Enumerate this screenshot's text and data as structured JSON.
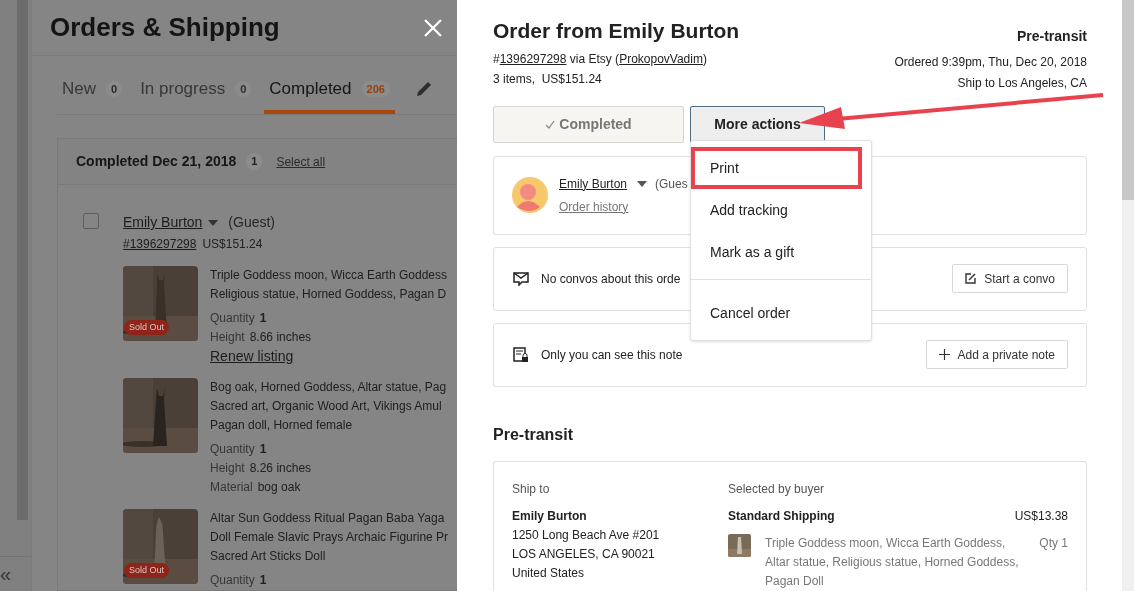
{
  "backdrop": {
    "collapse_glyph": "«"
  },
  "orders_panel": {
    "title": "Orders & Shipping",
    "tabs": [
      {
        "label": "New",
        "count": "0",
        "selected": false
      },
      {
        "label": "In progress",
        "count": "0",
        "selected": false
      },
      {
        "label": "Completed",
        "count": "206",
        "selected": true
      }
    ],
    "group": {
      "title": "Completed Dec 21, 2018",
      "count": "1",
      "select_all": "Select all"
    },
    "order": {
      "checked": false,
      "buyer": "Emily Burton",
      "buyer_note": "(Guest)",
      "number": "#1396297298",
      "total": "US$151.24",
      "items": [
        {
          "title_lines": [
            "Triple Goddess moon, Wicca Earth Goddess",
            "Religious statue, Horned Goddess, Pagan D"
          ],
          "sold_out": "Sold Out",
          "details": [
            {
              "label": "Quantity",
              "value": "1",
              "bold": true
            },
            {
              "label": "Height",
              "value": "8.66 inches",
              "bold": false
            }
          ],
          "link": "Renew listing"
        },
        {
          "title_lines": [
            "Bog oak, Horned Goddess, Altar statue, Pag",
            "Sacred art, Organic Wood Art, Vikings Amul",
            "Pagan doll, Horned female"
          ],
          "details": [
            {
              "label": "Quantity",
              "value": "1",
              "bold": true
            },
            {
              "label": "Height",
              "value": "8.26 inches",
              "bold": false
            },
            {
              "label": "Material",
              "value": "bog oak",
              "bold": false
            }
          ]
        },
        {
          "title_lines": [
            "Altar Sun Goddess Ritual Pagan Baba Yaga",
            "Doll Female Slavic Prays Archaic Figurine Pr",
            "Sacred Art Sticks Doll"
          ],
          "sold_out": "Sold Out",
          "details": [
            {
              "label": "Quantity",
              "value": "1",
              "bold": true
            }
          ]
        }
      ]
    }
  },
  "order_detail": {
    "title": "Order from Emily Burton",
    "number_prefix": "#",
    "number": "1396297298",
    "via": " via Etsy (",
    "shop": "ProkopovVadim",
    "shop_close": ")",
    "summary": "3 items,  US$151.24",
    "status": "Pre-transit",
    "ordered": "Ordered 9:39pm, Thu, Dec 20, 2018",
    "ship_to": "Ship to Los Angeles, CA",
    "buttons": [
      {
        "kind": "status",
        "label": "Completed"
      },
      {
        "kind": "menu",
        "label": "More actions",
        "expanded": true
      }
    ],
    "menu": [
      {
        "label": "Print",
        "highlighted": true,
        "separated": false
      },
      {
        "label": "Add tracking",
        "highlighted": false,
        "separated": false
      },
      {
        "label": "Mark as a gift",
        "highlighted": false,
        "separated": false
      },
      {
        "label": "Cancel order",
        "highlighted": false,
        "separated": true
      }
    ],
    "buyer": {
      "name": "Emily Burton",
      "note": "(Gues",
      "link": "Order history"
    },
    "cards": [
      {
        "kind": "convo",
        "text": "No convos about this orde",
        "button": "Start a convo"
      },
      {
        "kind": "note",
        "text": "Only you can see this note",
        "button": "Add a private note"
      }
    ],
    "shipping": {
      "title": "Pre-transit",
      "ship_to_label": "Ship to",
      "address": [
        "Emily Burton",
        "1250 Long Beach Ave #201",
        "LOS ANGELES, CA 90021",
        "United States"
      ],
      "selected_label": "Selected by buyer",
      "method": "Standard Shipping",
      "price": "US$13.38",
      "items": [
        {
          "title": "Triple Goddess moon, Wicca Earth Goddess, Altar statue, Religious statue, Horned Goddess, Pagan Doll",
          "qty": "Qty 1"
        }
      ]
    }
  }
}
